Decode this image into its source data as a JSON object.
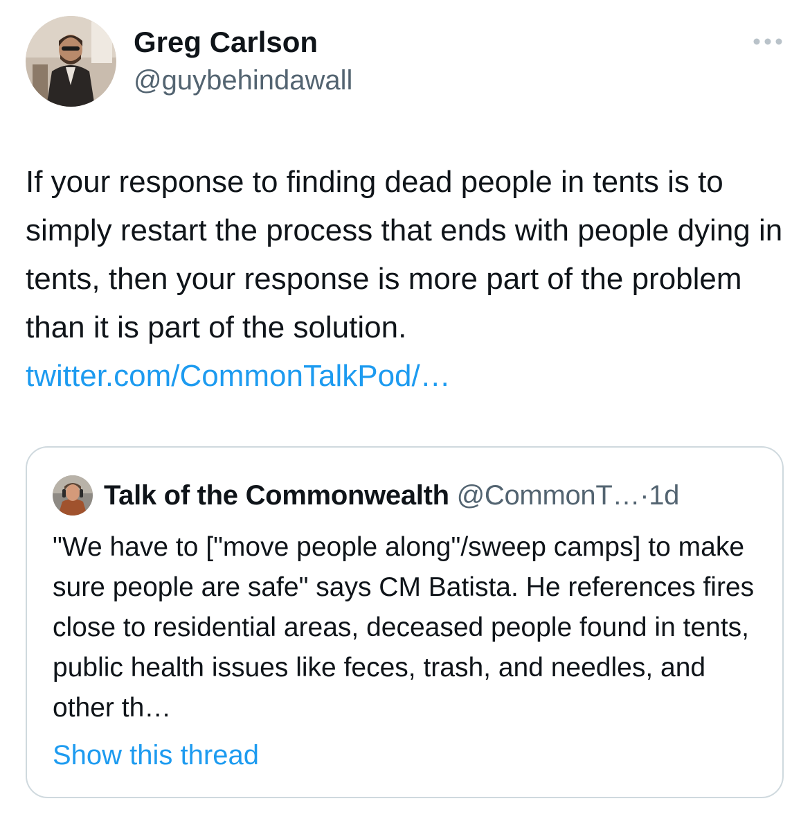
{
  "author": {
    "display_name": "Greg Carlson",
    "handle": "@guybehindawall",
    "avatar_icon": "profile-photo"
  },
  "tweet": {
    "text": "If your response to finding dead people in tents is to simply restart the process that ends with people dying in tents, then your response is more part of the problem than it is part of the solution.",
    "link": "twitter.com/CommonTalkPod/…"
  },
  "more_icon": "more-dots-icon",
  "quoted": {
    "display_name": "Talk of the Commonwealth",
    "handle": "@CommonT…",
    "separator": "·",
    "time": "1d",
    "text": "\"We have to [\"move people along\"/sweep camps] to make sure people are safe\" says CM Batista. He references fires close to residential areas, deceased people found in tents, public health issues like feces, trash, and needles, and other th…",
    "show_thread": "Show this thread",
    "avatar_icon": "profile-photo"
  },
  "colors": {
    "text": "#0f1419",
    "secondary": "#536471",
    "link": "#1d9bf0",
    "border": "#cfd9de"
  }
}
